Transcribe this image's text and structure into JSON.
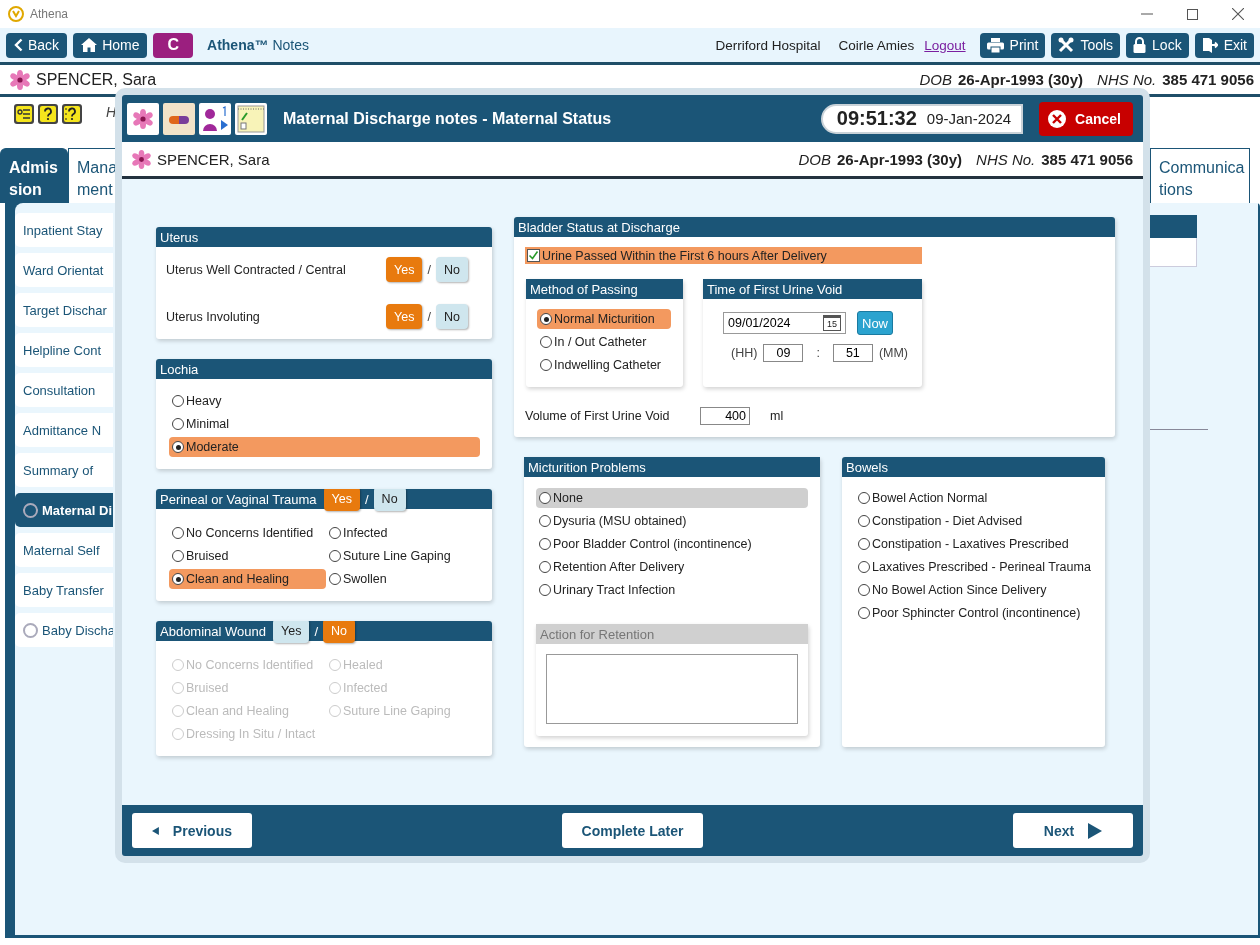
{
  "window": {
    "title": "Athena"
  },
  "nav": {
    "left_buttons": [
      {
        "kind": "back",
        "label": "Back"
      },
      {
        "kind": "home",
        "label": "Home"
      },
      {
        "kind": "letter",
        "label": "C"
      }
    ],
    "app_name": "**Athena™** Notes",
    "hospital": "Derriford Hospital",
    "user": "Coirle Amies",
    "logout": "Logout",
    "right_buttons": [
      {
        "kind": "print",
        "label": "Print"
      },
      {
        "kind": "tools",
        "label": "Tools"
      },
      {
        "kind": "lock",
        "label": "Lock"
      },
      {
        "kind": "exit",
        "label": "Exit"
      }
    ]
  },
  "patient": {
    "name": "SPENCER, Sara",
    "dob_label": "DOB",
    "dob": "26-Apr-1993 (30y)",
    "nhs_label": "NHS No.",
    "nhs": "385 471 9056"
  },
  "toolbar": {
    "cut_text": "H"
  },
  "tabs": [
    {
      "label": "Admis sion",
      "selected": true
    },
    {
      "label": "Mana ment",
      "selected": false
    },
    {
      "label": "Communica tions",
      "selected": false
    }
  ],
  "sidebar": {
    "items": [
      {
        "label": "Inpatient Stay",
        "kind": "plain",
        "selected": false
      },
      {
        "label": "Ward Orientat",
        "kind": "plain",
        "selected": false
      },
      {
        "label": "Target Dischar",
        "kind": "plain",
        "selected": false
      },
      {
        "label": "Helpline Cont",
        "kind": "plain",
        "selected": false
      },
      {
        "label": "Consultation",
        "kind": "plain",
        "selected": false
      },
      {
        "label": "Admittance N",
        "kind": "plain",
        "selected": false
      },
      {
        "label": "Summary of",
        "kind": "plain",
        "selected": false
      },
      {
        "label": "Maternal Di",
        "kind": "radio",
        "selected": true
      },
      {
        "label": "Maternal Self",
        "kind": "plain",
        "selected": false
      },
      {
        "label": "Baby Transfer",
        "kind": "plain",
        "selected": false
      },
      {
        "label": "Baby Discha",
        "kind": "radio",
        "selected": false
      }
    ]
  },
  "modal": {
    "title": "Maternal Discharge notes - Maternal Status",
    "time": "09:51:32",
    "date": "09-Jan-2024",
    "cancel": "Cancel",
    "patient": {
      "name": "SPENCER, Sara",
      "dob_label": "DOB",
      "dob": "26-Apr-1993 (30y)",
      "nhs_label": "NHS No.",
      "nhs": "385 471 9056"
    },
    "uterus": {
      "title": "Uterus",
      "rows": [
        {
          "label": "Uterus Well Contracted / Central",
          "toggle": {
            "yes": {
              "label": "Yes",
              "selected": true
            },
            "sep": "/",
            "no": {
              "label": "No",
              "selected": false
            }
          }
        },
        {
          "label": "Uterus Involuting",
          "toggle": {
            "yes": {
              "label": "Yes",
              "selected": true
            },
            "sep": "/",
            "no": {
              "label": "No",
              "selected": false
            }
          }
        }
      ]
    },
    "lochia": {
      "title": "Lochia",
      "options": [
        {
          "label": "Heavy",
          "selected": false
        },
        {
          "label": "Minimal",
          "selected": false
        },
        {
          "label": "Moderate",
          "selected": true
        }
      ]
    },
    "perineal": {
      "title": "Perineal or Vaginal Trauma",
      "toggle": {
        "yes": {
          "label": "Yes",
          "selected": true
        },
        "sep": "/",
        "no": {
          "label": "No",
          "selected": false
        }
      },
      "options": [
        {
          "label": "No Concerns Identified",
          "selected": false
        },
        {
          "label": "Infected",
          "selected": false
        },
        {
          "label": "Bruised",
          "selected": false
        },
        {
          "label": "Suture Line Gaping",
          "selected": false
        },
        {
          "label": "Clean and Healing",
          "selected": true
        },
        {
          "label": "Swollen",
          "selected": false
        }
      ]
    },
    "abdominal": {
      "title": "Abdominal Wound",
      "toggle": {
        "yes": {
          "label": "Yes",
          "selected": false
        },
        "sep": "/",
        "no": {
          "label": "No",
          "selected": true
        }
      },
      "disabled": true,
      "options": [
        {
          "label": "No Concerns Identified",
          "selected": false
        },
        {
          "label": "Healed",
          "selected": false
        },
        {
          "label": "Bruised",
          "selected": false
        },
        {
          "label": "Infected",
          "selected": false
        },
        {
          "label": "Clean and Healing",
          "selected": false
        },
        {
          "label": "Suture Line Gaping",
          "selected": false
        },
        {
          "label": "Dressing In Situ / Intact",
          "selected": false
        }
      ]
    },
    "bladder": {
      "title": "Bladder Status at Discharge",
      "checkbox": {
        "label": "Urine Passed Within the First 6 hours After Delivery",
        "checked": true
      },
      "method": {
        "title": "Method of Passing",
        "options": [
          {
            "label": "Normal Micturition",
            "selected": true
          },
          {
            "label": "In / Out Catheter",
            "selected": false
          },
          {
            "label": "Indwelling Catheter",
            "selected": false
          }
        ]
      },
      "time": {
        "title": "Time of First Urine Void",
        "date": "09/01/2024",
        "calendar_day": "15",
        "now": "Now",
        "hh_label": "(HH)",
        "hh": "09",
        "colon": ":",
        "mm": "51",
        "mm_label": "(MM)"
      },
      "volume": {
        "label": "Volume of First Urine Void",
        "value": "400",
        "unit": "ml"
      }
    },
    "micturition": {
      "title": "Micturition Problems",
      "options": [
        {
          "label": "None",
          "selected": false,
          "highlighted": true
        },
        {
          "label": "Dysuria (MSU obtained)",
          "selected": false,
          "highlighted": false
        },
        {
          "label": "Poor Bladder Control (incontinence)",
          "selected": false,
          "highlighted": false
        },
        {
          "label": "Retention After Delivery",
          "selected": false,
          "highlighted": false
        },
        {
          "label": "Urinary Tract Infection",
          "selected": false,
          "highlighted": false
        }
      ],
      "action": {
        "title": "Action for Retention",
        "disabled": true
      }
    },
    "bowels": {
      "title": "Bowels",
      "options": [
        {
          "label": "Bowel Action Normal",
          "selected": false
        },
        {
          "label": "Constipation - Diet Advised",
          "selected": false
        },
        {
          "label": "Constipation - Laxatives Prescribed",
          "selected": false
        },
        {
          "label": "Laxatives Prescribed - Perineal Trauma",
          "selected": false
        },
        {
          "label": "No Bowel Action Since Delivery",
          "selected": false
        },
        {
          "label": "Poor Sphincter Control (incontinence)",
          "selected": false
        }
      ]
    },
    "footer": {
      "previous": "Previous",
      "complete_later": "Complete Later",
      "next": "Next"
    }
  }
}
